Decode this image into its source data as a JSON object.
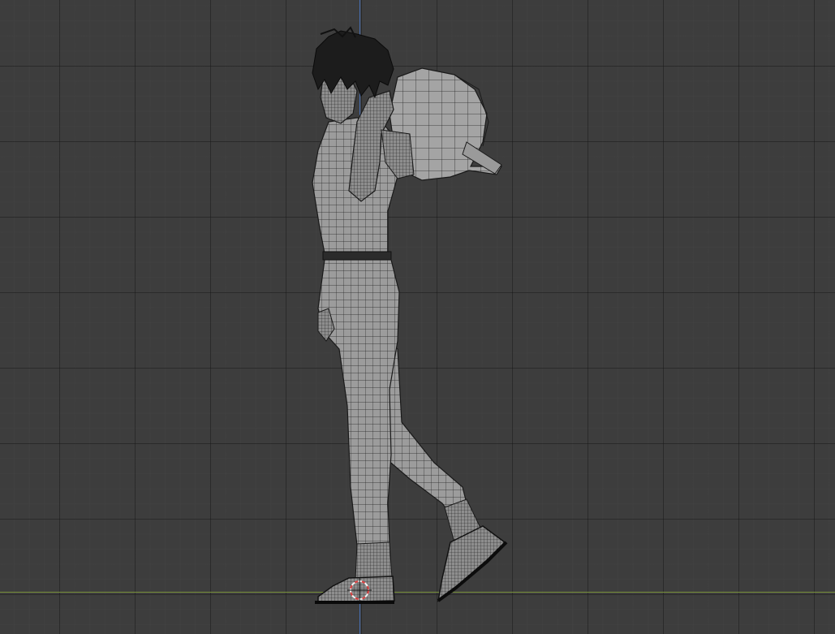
{
  "viewport": {
    "background_color": "#3d3d3d",
    "grid_major_color": "#2a2a2a",
    "grid_minor_color": "#464646",
    "axis_z_color": "#4a78c8",
    "axis_y_color": "#7f9a3c",
    "mesh_fill_color": "#9a9a9a",
    "wire_color": "#1a1a1a",
    "cursor_color": "#e04040"
  },
  "scene": {
    "object": "character-mesh",
    "view": "side-orthographic",
    "display": "wireframe-overlay"
  }
}
